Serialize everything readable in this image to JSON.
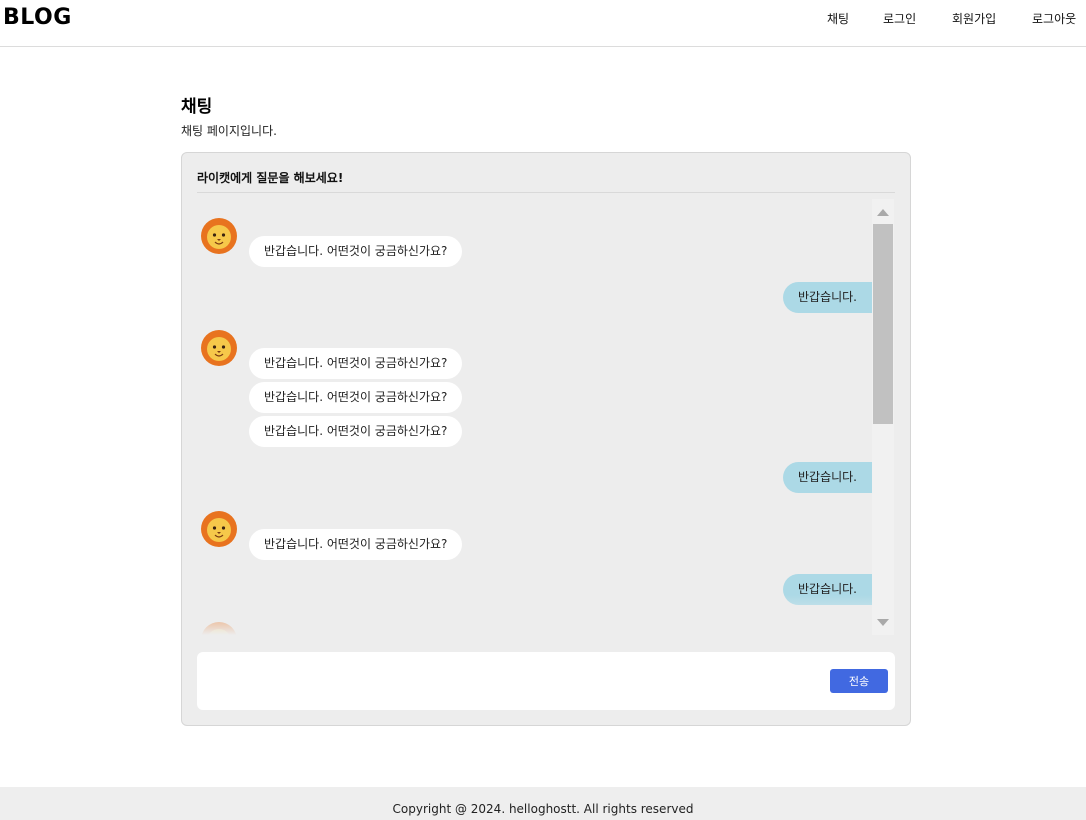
{
  "header": {
    "logo": "BLOG",
    "nav": [
      "채팅",
      "로그인",
      "회원가입",
      "로그아웃"
    ]
  },
  "page": {
    "title": "채팅",
    "description": "채팅 페이지입니다."
  },
  "chat": {
    "header": "라이캣에게 질문을 해보세요!",
    "messages": [
      {
        "from": "bot",
        "avatar": "lion-cat-icon",
        "text": "반갑습니다. 어떤것이 궁금하신가요?"
      },
      {
        "from": "user",
        "text": "반갑습니다."
      },
      {
        "from": "bot",
        "avatar": "lion-cat-icon",
        "text": "반갑습니다. 어떤것이 궁금하신가요?"
      },
      {
        "from": "bot",
        "text": "반갑습니다. 어떤것이 궁금하신가요?"
      },
      {
        "from": "bot",
        "text": "반갑습니다. 어떤것이 궁금하신가요?"
      },
      {
        "from": "user",
        "text": "반갑습니다."
      },
      {
        "from": "bot",
        "avatar": "lion-cat-icon",
        "text": "반갑습니다. 어떤것이 궁금하신가요?"
      },
      {
        "from": "user",
        "text": "반갑습니다."
      }
    ],
    "input": {
      "value": "",
      "placeholder": ""
    },
    "send_label": "전송"
  },
  "footer": {
    "text": "Copyright @ 2024. helloghostt. All rights reserved"
  },
  "colors": {
    "user_bubble": "#acd9e6",
    "bot_bubble": "#ffffff",
    "card_bg": "#ededed",
    "send_button": "#4169e1",
    "avatar_mane": "#e8731f",
    "avatar_face": "#f6c84a"
  }
}
